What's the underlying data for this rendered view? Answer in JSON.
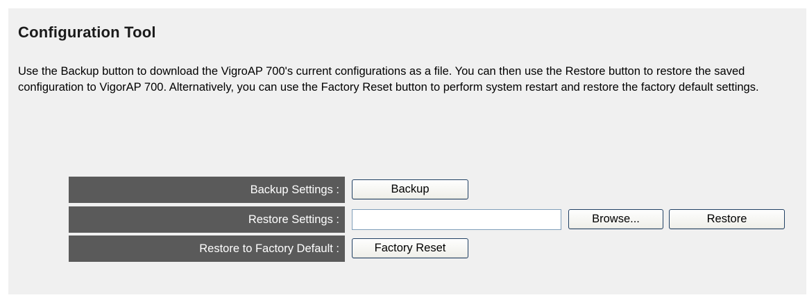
{
  "page": {
    "title": "Configuration Tool",
    "description": "Use the Backup button to download the VigroAP 700's current configurations as a file. You can then use the Restore button to restore the saved configuration to VigorAP 700. Alternatively, you can use the Factory Reset button to perform system restart and restore the factory default settings."
  },
  "rows": {
    "backup": {
      "label": "Backup Settings :",
      "button": "Backup"
    },
    "restore": {
      "label": "Restore Settings :",
      "file_value": "",
      "browse_button": "Browse...",
      "button": "Restore"
    },
    "factory": {
      "label": "Restore to Factory Default :",
      "button": "Factory Reset"
    }
  },
  "colors": {
    "label_background": "#5a5a5a",
    "panel_background": "#f0f0f0",
    "button_border": "#1f3f63"
  }
}
